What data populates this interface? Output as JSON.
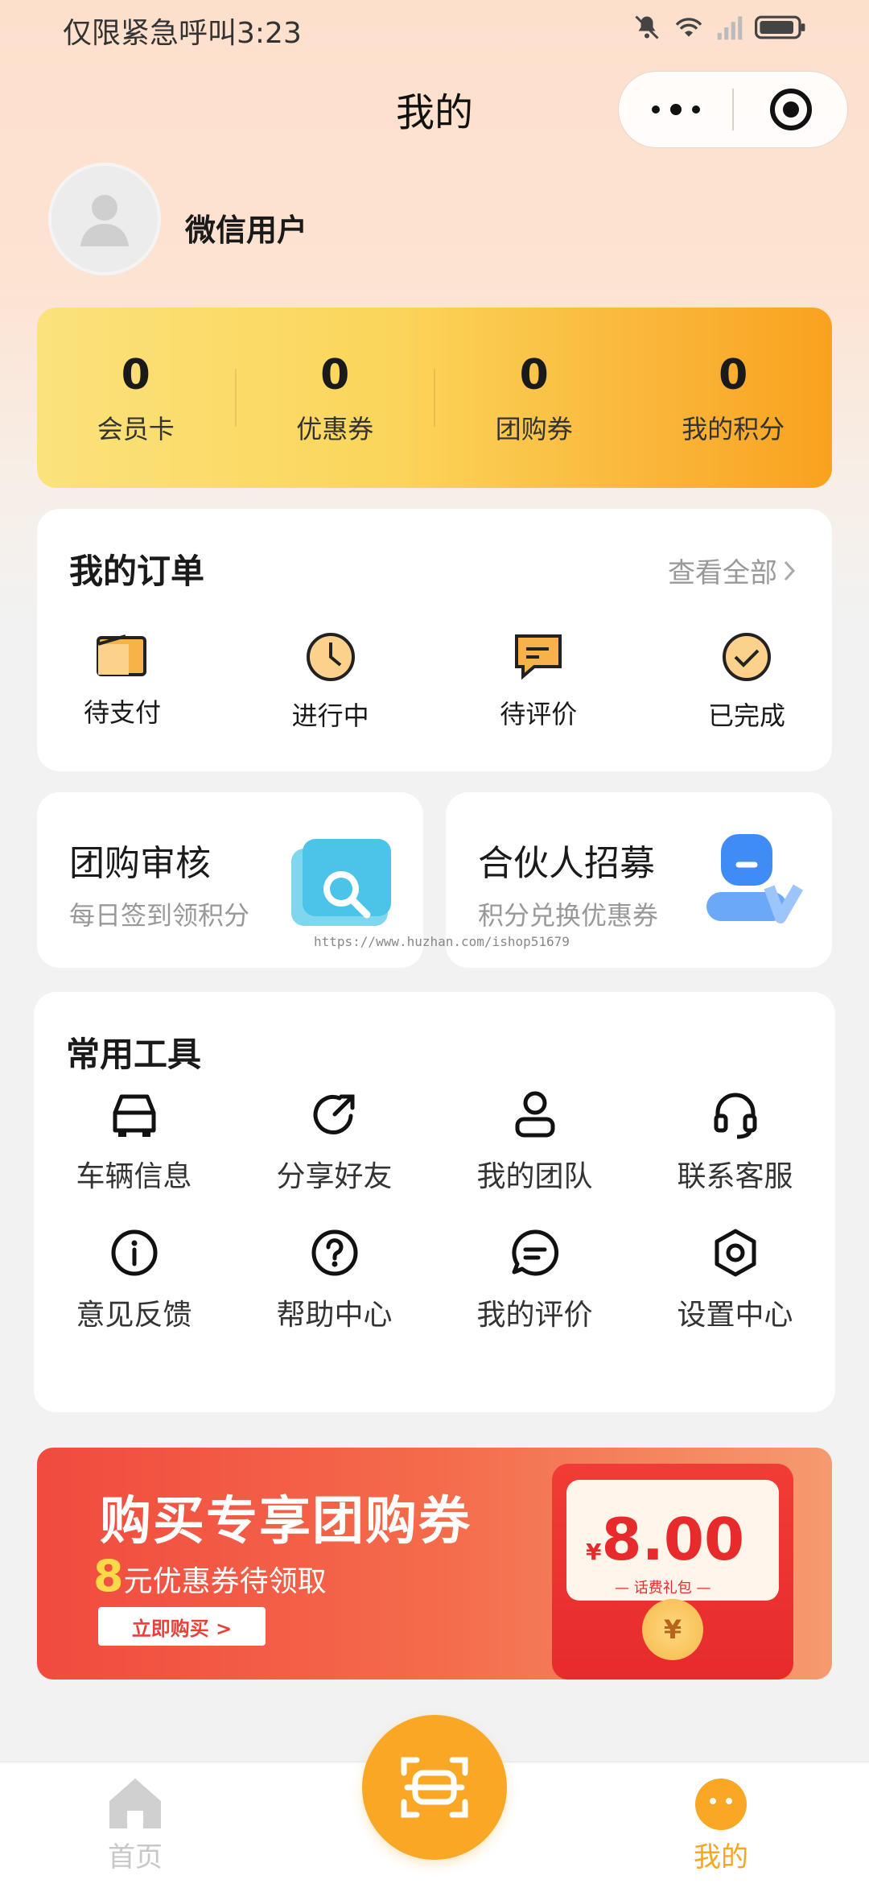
{
  "status_bar": {
    "left_text": "仅限紧急呼叫3:23"
  },
  "header": {
    "title": "我的"
  },
  "profile": {
    "username": "微信用户"
  },
  "stats": [
    {
      "value": "0",
      "label": "会员卡"
    },
    {
      "value": "0",
      "label": "优惠券"
    },
    {
      "value": "0",
      "label": "团购券"
    },
    {
      "value": "0",
      "label": "我的积分"
    }
  ],
  "orders": {
    "title": "我的订单",
    "view_all": "查看全部",
    "items": [
      {
        "label": "待支付",
        "icon": "wallet-icon"
      },
      {
        "label": "进行中",
        "icon": "clock-icon"
      },
      {
        "label": "待评价",
        "icon": "comment-icon"
      },
      {
        "label": "已完成",
        "icon": "check-circle-icon"
      }
    ]
  },
  "promos": [
    {
      "title": "团购审核",
      "subtitle": "每日签到领积分",
      "icon": "search-card-icon"
    },
    {
      "title": "合伙人招募",
      "subtitle": "积分兑换优惠券",
      "icon": "partner-user-icon"
    }
  ],
  "watermark": "https://www.huzhan.com/ishop51679",
  "tools": {
    "title": "常用工具",
    "items": [
      {
        "label": "车辆信息",
        "icon": "car-icon"
      },
      {
        "label": "分享好友",
        "icon": "share-icon"
      },
      {
        "label": "我的团队",
        "icon": "user-icon"
      },
      {
        "label": "联系客服",
        "icon": "headset-icon"
      },
      {
        "label": "意见反馈",
        "icon": "info-icon"
      },
      {
        "label": "帮助中心",
        "icon": "help-icon"
      },
      {
        "label": "我的评价",
        "icon": "chat-icon"
      },
      {
        "label": "设置中心",
        "icon": "settings-icon"
      }
    ]
  },
  "banner": {
    "title": "购买专享团购券",
    "sub_amount": "8",
    "sub_text": "元优惠券待领取",
    "button": "立即购买 >",
    "envelope_yen": "¥",
    "envelope_amount": "8.00",
    "envelope_caption": "— 话费礼包 —",
    "coin_symbol": "¥"
  },
  "tabbar": {
    "home": "首页",
    "me": "我的"
  },
  "colors": {
    "accent": "#f9a724",
    "banner_red": "#f14a3f"
  }
}
